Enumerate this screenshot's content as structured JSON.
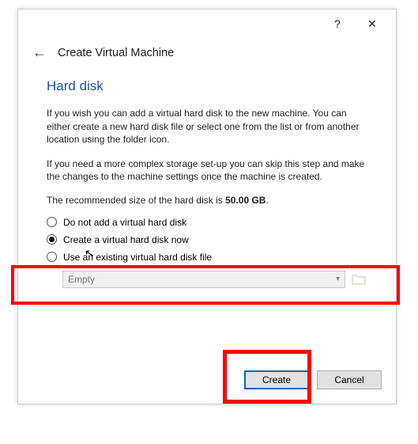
{
  "titlebar": {
    "help_label": "?",
    "close_label": "✕"
  },
  "header": {
    "back_glyph": "←",
    "title": "Create Virtual Machine"
  },
  "section": {
    "title": "Hard disk",
    "para1": "If you wish you can add a virtual hard disk to the new machine. You can either create a new hard disk file or select one from the list or from another location using the folder icon.",
    "para2": "If you need a more complex storage set-up you can skip this step and make the changes to the machine settings once the machine is created.",
    "recommended_prefix": "The recommended size of the hard disk is ",
    "recommended_value": "50.00 GB",
    "recommended_suffix": "."
  },
  "options": {
    "opt1": "Do not add a virtual hard disk",
    "opt2": "Create a virtual hard disk now",
    "opt3": "Use an existing virtual hard disk file",
    "selected_index": 1
  },
  "file_select": {
    "value": "Empty",
    "enabled": false
  },
  "footer": {
    "create_label": "Create",
    "cancel_label": "Cancel"
  }
}
